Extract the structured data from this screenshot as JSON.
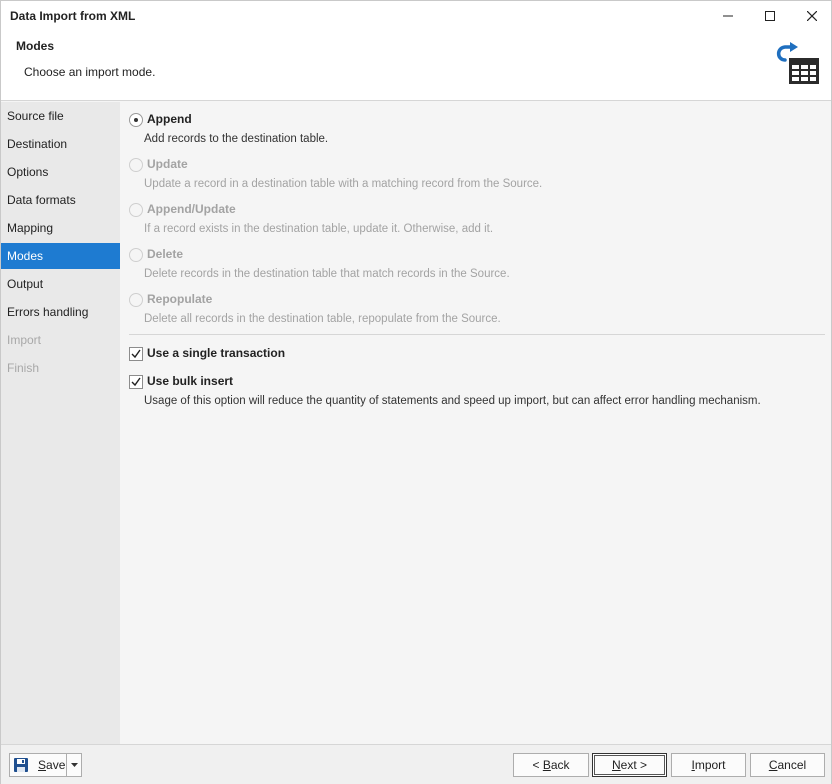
{
  "window": {
    "title": "Data Import from XML",
    "controls": {
      "minimize": "minimize-icon",
      "maximize": "maximize-icon",
      "close": "close-icon"
    }
  },
  "header": {
    "title": "Modes",
    "subtitle": "Choose an import mode.",
    "icon": "import-table-icon"
  },
  "sidebar": {
    "items": [
      {
        "label": "Source file",
        "state": "normal"
      },
      {
        "label": "Destination",
        "state": "normal"
      },
      {
        "label": "Options",
        "state": "normal"
      },
      {
        "label": "Data formats",
        "state": "normal"
      },
      {
        "label": "Mapping",
        "state": "normal"
      },
      {
        "label": "Modes",
        "state": "active"
      },
      {
        "label": "Output",
        "state": "normal"
      },
      {
        "label": "Errors handling",
        "state": "normal"
      },
      {
        "label": "Import",
        "state": "disabled"
      },
      {
        "label": "Finish",
        "state": "disabled"
      }
    ]
  },
  "modes": [
    {
      "label": "Append",
      "description": "Add records to the destination table.",
      "selected": true,
      "enabled": true
    },
    {
      "label": "Update",
      "description": "Update a record in a destination table with a matching record from the Source.",
      "selected": false,
      "enabled": false
    },
    {
      "label": "Append/Update",
      "description": "If a record exists in the destination table, update it. Otherwise, add it.",
      "selected": false,
      "enabled": false
    },
    {
      "label": "Delete",
      "description": "Delete records in the destination table that match records in the Source.",
      "selected": false,
      "enabled": false
    },
    {
      "label": "Repopulate",
      "description": "Delete all records in the destination table, repopulate from the Source.",
      "selected": false,
      "enabled": false
    }
  ],
  "options": {
    "single_transaction": {
      "label": "Use a single transaction",
      "checked": true
    },
    "bulk_insert": {
      "label": "Use bulk insert",
      "checked": true,
      "description": "Usage of this option will reduce the quantity of statements and speed up import, but can affect error handling mechanism."
    }
  },
  "footer": {
    "save": {
      "label": "Save",
      "accelerator": "S",
      "icon": "floppy-disk-icon"
    },
    "back": {
      "label": "< Back",
      "accelerator": "B"
    },
    "next": {
      "label": "Next >",
      "accelerator": "N"
    },
    "import": {
      "label": "Import",
      "accelerator": "I"
    },
    "cancel": {
      "label": "Cancel",
      "accelerator": "C"
    }
  },
  "colors": {
    "accent": "#1e7bd1",
    "icon_dark": "#2b2b2b",
    "icon_blue": "#1f6fbf"
  }
}
